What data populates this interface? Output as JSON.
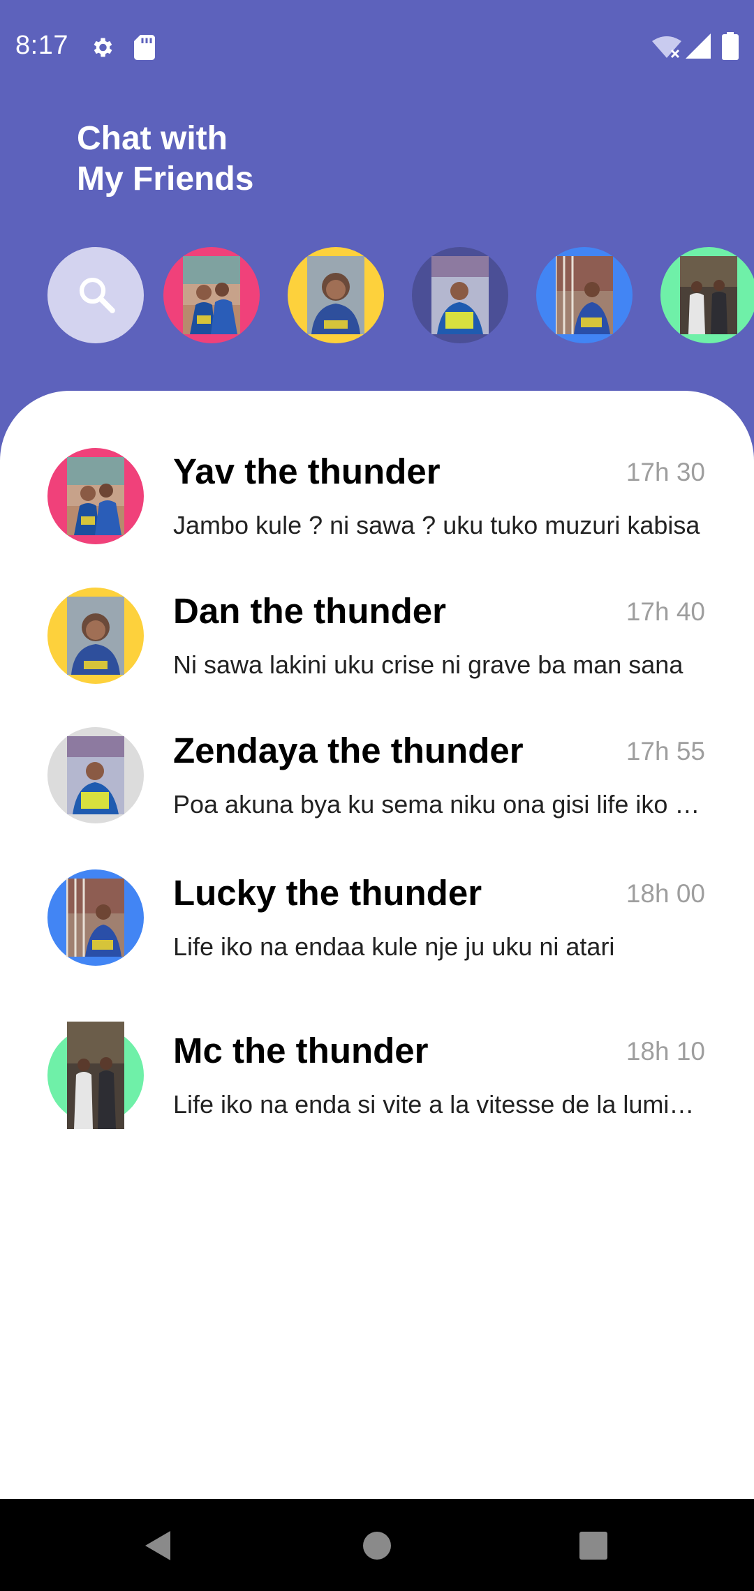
{
  "status_bar": {
    "time": "8:17",
    "icons": [
      "gear-icon",
      "sd-card-icon",
      "wifi-off-icon",
      "signal-icon",
      "battery-icon"
    ]
  },
  "header": {
    "title_line1": "Chat with",
    "title_line2": "My Friends"
  },
  "stories": {
    "search_icon": "search-icon",
    "ring_colors": [
      "#f0417a",
      "#fdd13c",
      "#4b4f96",
      "#4285f4",
      "#6ff0a8"
    ]
  },
  "chats": [
    {
      "name": "Yav the thunder",
      "time": "17h 30",
      "message": "Jambo kule ? ni sawa ? uku tuko muzuri kabisa",
      "ring_color": "#f0417a"
    },
    {
      "name": "Dan the thunder",
      "time": "17h 40",
      "message": "Ni sawa lakini uku crise ni grave ba man sana",
      "ring_color": "#fdd13c"
    },
    {
      "name": "Zendaya the thunder",
      "time": "17h 55",
      "message": "Poa akuna bya ku sema niku ona gisi life iko sawa",
      "ring_color": "#dcdcdc"
    },
    {
      "name": "Lucky the thunder",
      "time": "18h 00",
      "message": "Life iko na endaa kule nje ju uku ni atari",
      "ring_color": "#4285f4"
    },
    {
      "name": "Mc the thunder",
      "time": "18h 10",
      "message": "Life iko na enda si vite a la vitesse de la lumiere",
      "ring_color": "#6ff0a8"
    }
  ],
  "nav": {
    "icons": [
      "back-icon",
      "home-icon",
      "recents-icon"
    ]
  },
  "colors": {
    "header_bg": "#5d62bc",
    "search_bg": "#d3d3ef",
    "time_text": "#9e9e9e"
  }
}
